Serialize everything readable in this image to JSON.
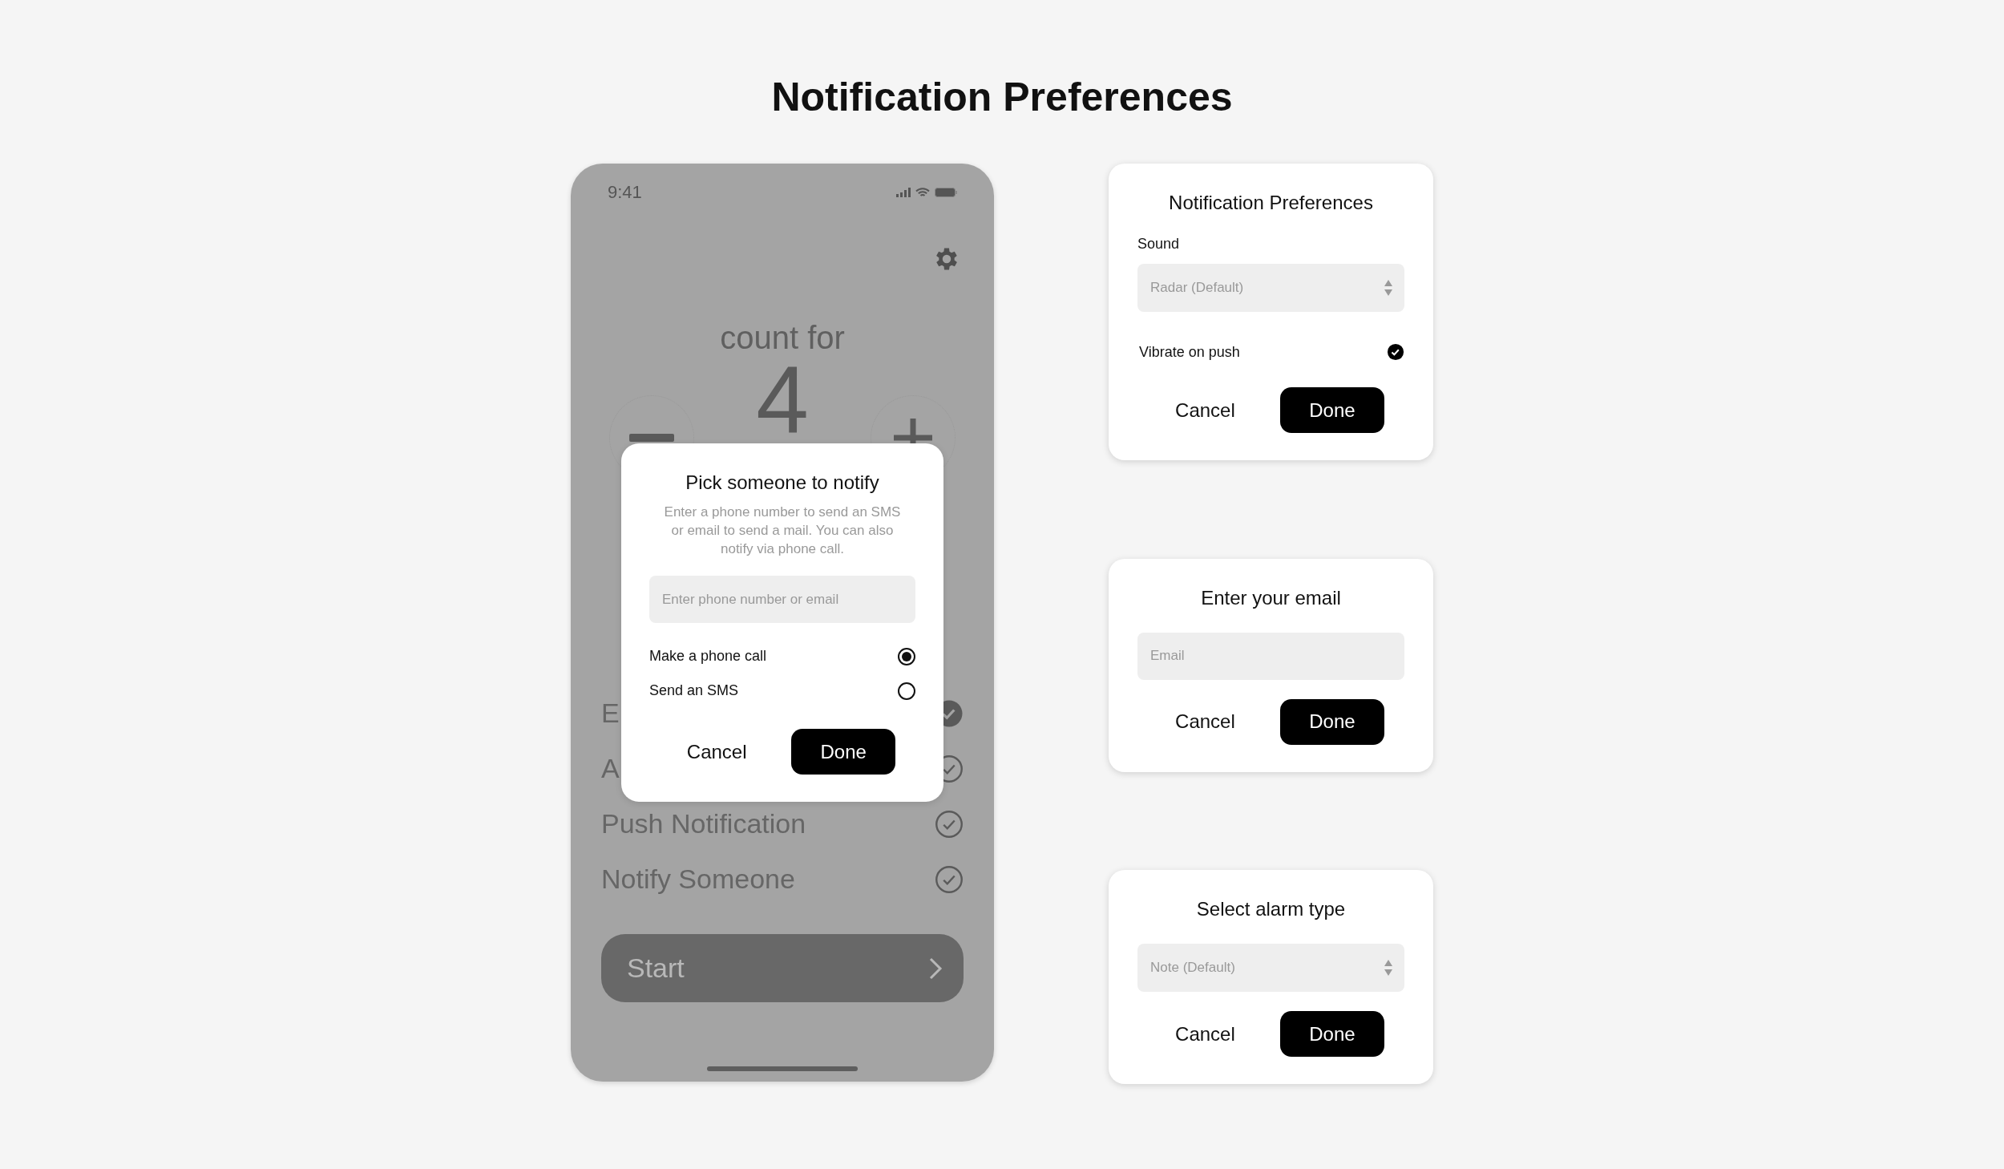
{
  "title": "Notification Preferences",
  "phone": {
    "status_bar": {
      "time": "9:41"
    },
    "counter": {
      "label": "count for",
      "value": "4"
    },
    "options": [
      {
        "label": "E",
        "checked": true
      },
      {
        "label": "A",
        "checked": false
      },
      {
        "label": "Push Notification",
        "checked": false
      },
      {
        "label": "Notify Someone",
        "checked": false
      }
    ],
    "start_button": "Start",
    "dialog": {
      "title": "Pick someone to notify",
      "description": "Enter a phone number to send an SMS or email to send a mail. You can also notify via phone call.",
      "input": {
        "placeholder": "Enter phone number or email"
      },
      "choices": [
        {
          "label": "Make a phone call",
          "selected": true
        },
        {
          "label": "Send an SMS",
          "selected": false
        }
      ],
      "buttons": [
        {
          "label": "Cancel",
          "kind": "plain"
        },
        {
          "label": "Done",
          "kind": "primary"
        }
      ]
    }
  },
  "cards": [
    {
      "title": "Notification Preferences",
      "fields": [
        {
          "kind": "select",
          "label": "Sound",
          "value": "Radar (Default)"
        },
        {
          "kind": "check",
          "label": "Vibrate on push",
          "checked": true
        }
      ],
      "buttons": [
        {
          "label": "Cancel",
          "kind": "plain"
        },
        {
          "label": "Done",
          "kind": "primary"
        }
      ]
    },
    {
      "title": "Enter your email",
      "fields": [
        {
          "kind": "input",
          "placeholder": "Email"
        }
      ],
      "buttons": [
        {
          "label": "Cancel",
          "kind": "plain"
        },
        {
          "label": "Done",
          "kind": "primary"
        }
      ]
    },
    {
      "title": "Select alarm type",
      "fields": [
        {
          "kind": "select",
          "value": "Note (Default)"
        }
      ],
      "buttons": [
        {
          "label": "Cancel",
          "kind": "plain"
        },
        {
          "label": "Done",
          "kind": "primary"
        }
      ]
    }
  ]
}
